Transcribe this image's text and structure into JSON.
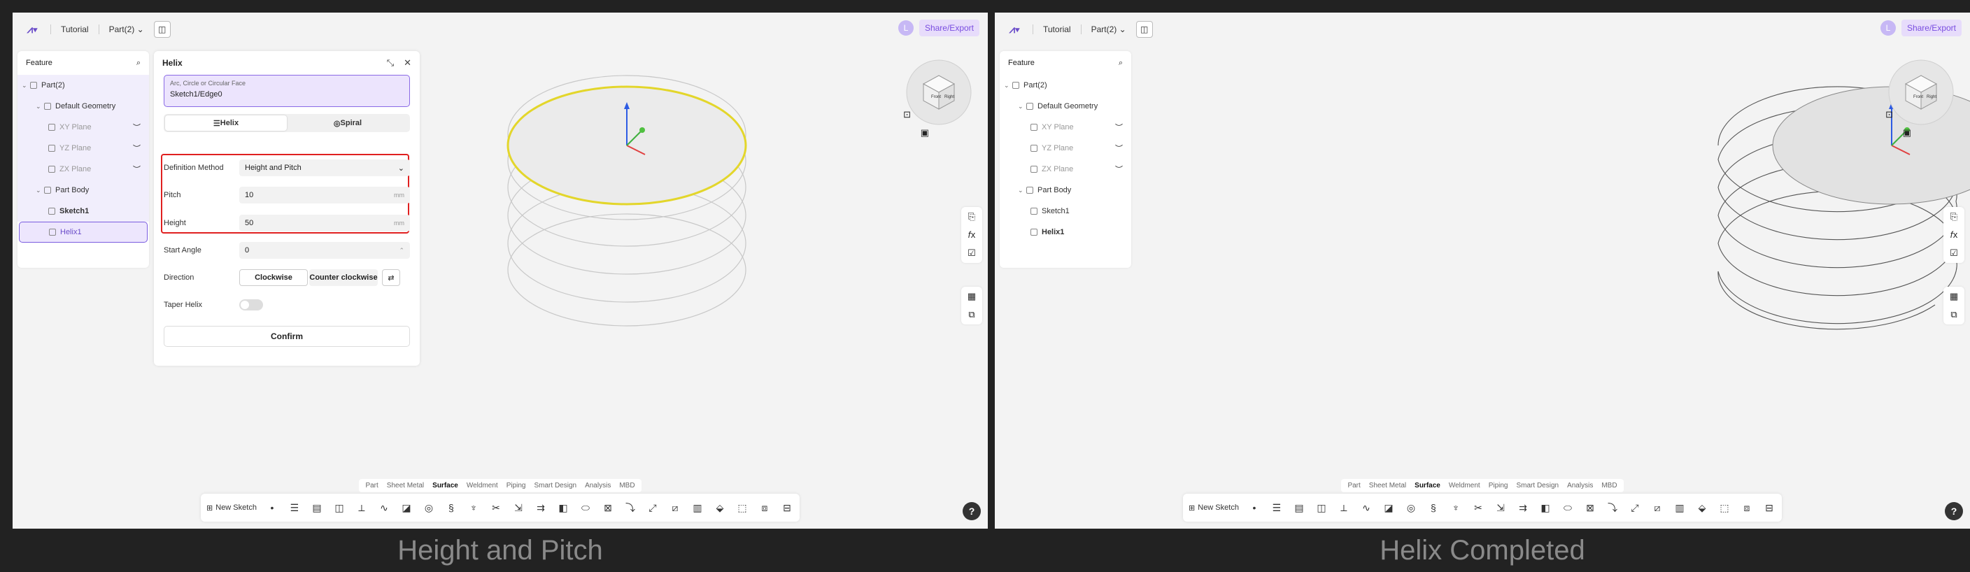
{
  "left": {
    "caption": "Height and Pitch",
    "topbar": {
      "tutorial": "Tutorial",
      "part": "Part(2)",
      "share": "Share/Export",
      "avatar": "L"
    },
    "tree": {
      "title": "Feature",
      "items": [
        {
          "label": "Part(2)"
        },
        {
          "label": "Default Geometry"
        },
        {
          "label": "XY Plane"
        },
        {
          "label": "YZ Plane"
        },
        {
          "label": "ZX Plane"
        },
        {
          "label": "Part Body"
        },
        {
          "label": "Sketch1"
        },
        {
          "label": "Helix1"
        }
      ]
    },
    "helix": {
      "title": "Helix",
      "edge_label": "Arc, Circle or Circular Face",
      "edge_value": "Sketch1/Edge0",
      "tab_helix": "Helix",
      "tab_spiral": "Spiral",
      "def_label": "Definition Method",
      "def_value": "Height and Pitch",
      "pitch_label": "Pitch",
      "pitch_value": "10",
      "height_label": "Height",
      "height_value": "50",
      "unit": "mm",
      "start_label": "Start Angle",
      "start_value": "0",
      "dir_label": "Direction",
      "dir_cw": "Clockwise",
      "dir_ccw": "Counter clockwise",
      "taper_label": "Taper Helix",
      "confirm": "Confirm"
    },
    "bottom_tabs": [
      "Part",
      "Sheet Metal",
      "Surface",
      "Weldment",
      "Piping",
      "Smart Design",
      "Analysis",
      "MBD"
    ],
    "active_tab": "Surface",
    "new_sketch": "New Sketch"
  },
  "right": {
    "caption": "Helix Completed",
    "topbar": {
      "tutorial": "Tutorial",
      "part": "Part(2)",
      "share": "Share/Export",
      "avatar": "L"
    },
    "tree": {
      "title": "Feature",
      "items": [
        {
          "label": "Part(2)"
        },
        {
          "label": "Default Geometry"
        },
        {
          "label": "XY Plane"
        },
        {
          "label": "YZ Plane"
        },
        {
          "label": "ZX Plane"
        },
        {
          "label": "Part Body"
        },
        {
          "label": "Sketch1"
        },
        {
          "label": "Helix1"
        }
      ]
    },
    "bottom_tabs": [
      "Part",
      "Sheet Metal",
      "Surface",
      "Weldment",
      "Piping",
      "Smart Design",
      "Analysis",
      "MBD"
    ],
    "new_sketch": "New Sketch"
  },
  "colors": {
    "accent": "#7a4ee0",
    "highlight_red": "#e02020",
    "edge_yellow": "#e3d62b"
  },
  "cube_faces": {
    "front": "Front",
    "right": "Right"
  },
  "help": "?"
}
